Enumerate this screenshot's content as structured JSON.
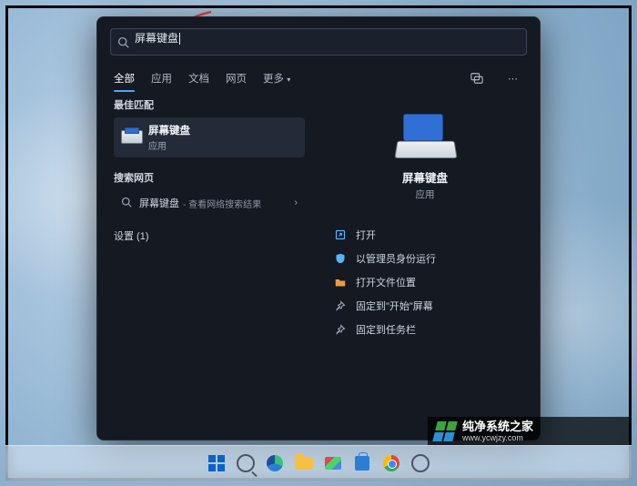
{
  "search": {
    "value": "屏幕键盘"
  },
  "tabs": {
    "all": "全部",
    "apps": "应用",
    "docs": "文档",
    "web": "网页",
    "more": "更多"
  },
  "sections": {
    "best": "最佳匹配",
    "web": "搜索网页",
    "settings": "设置 (1)"
  },
  "bestMatch": {
    "title": "屏幕键盘",
    "subtitle": "应用"
  },
  "webResult": {
    "term": "屏幕键盘",
    "hint": "- 查看网络搜索结果"
  },
  "preview": {
    "title": "屏幕键盘",
    "subtitle": "应用"
  },
  "actions": {
    "open": "打开",
    "admin": "以管理员身份运行",
    "location": "打开文件位置",
    "pinStart": "固定到\"开始\"屏幕",
    "pinTaskbar": "固定到任务栏"
  },
  "watermark": {
    "title": "纯净系统之家",
    "url": "www.ycwjzy.com"
  }
}
